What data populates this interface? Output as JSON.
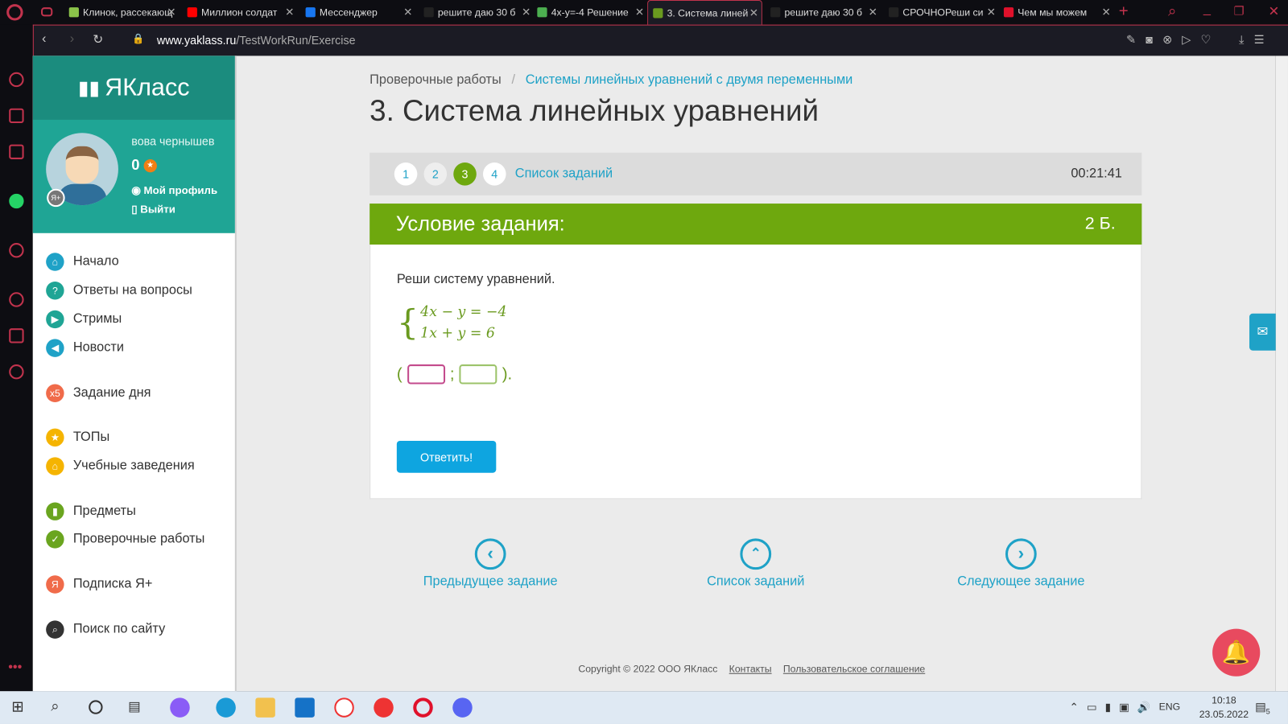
{
  "browser": {
    "tabs": [
      {
        "label": "Клинок, рассекающ",
        "color": "#8bc34a"
      },
      {
        "label": "Миллион солдат",
        "color": "#ff0000"
      },
      {
        "label": "Мессенджер",
        "color": "#1877f2"
      },
      {
        "label": "решите даю 30 б",
        "color": "#222"
      },
      {
        "label": "4x-y=-4 Решение",
        "color": "#4caf50"
      },
      {
        "label": "3. Система линей",
        "color": "#6a9a1f"
      },
      {
        "label": "решите даю 30 б",
        "color": "#222"
      },
      {
        "label": "СРОЧНОРеши си",
        "color": "#222"
      },
      {
        "label": "Чем мы можем",
        "color": "#e0112b"
      }
    ],
    "url_domain": "www.yaklass.ru",
    "url_path": "/TestWorkRun/Exercise",
    "add_tab": "+"
  },
  "site": {
    "logo": "ЯКласс",
    "user": {
      "name": "вова чернышев",
      "points": "0",
      "profile": "Мой профиль",
      "logout": "Выйти",
      "badge": "Я+"
    },
    "nav": [
      {
        "label": "Начало",
        "icon": "home-icon",
        "color": "#1fa2c7"
      },
      {
        "label": "Ответы на вопросы",
        "icon": "question-icon",
        "color": "#1fa595"
      },
      {
        "label": "Стримы",
        "icon": "play-icon",
        "color": "#1fa595"
      },
      {
        "label": "Новости",
        "icon": "megaphone-icon",
        "color": "#1fa2c7"
      },
      {
        "label": "Задание дня",
        "icon": "x5-icon",
        "color": "#f06b4a"
      },
      {
        "label": "ТОПы",
        "icon": "star-icon",
        "color": "#f5b400"
      },
      {
        "label": "Учебные заведения",
        "icon": "school-icon",
        "color": "#f5b400"
      },
      {
        "label": "Предметы",
        "icon": "book-icon",
        "color": "#6aa51f"
      },
      {
        "label": "Проверочные работы",
        "icon": "check-icon",
        "color": "#6aa51f"
      },
      {
        "label": "Подписка Я+",
        "icon": "subscription-icon",
        "color": "#f06b4a"
      },
      {
        "label": "Поиск по сайту",
        "icon": "search-icon",
        "color": "#333"
      }
    ]
  },
  "main": {
    "breadcrumb_root": "Проверочные работы",
    "breadcrumb_sep": "/",
    "breadcrumb_current": "Системы линейных уравнений с двумя переменными",
    "title": "3. Система линейных уравнений",
    "steps": [
      "1",
      "2",
      "3",
      "4"
    ],
    "task_list_link": "Список заданий",
    "timer": "00:21:41",
    "condition_label": "Условие задания:",
    "points": "2 Б.",
    "prompt": "Реши систему уравнений.",
    "eq1": "4x − y = −4",
    "eq2": "1x + y = 6",
    "paren_open": "(",
    "semicolon": ";",
    "paren_close": ").",
    "answer_x": "",
    "answer_y": "",
    "submit": "Ответить!",
    "prev": "Предыдущее задание",
    "list": "Список заданий",
    "next": "Следующее задание",
    "copyright": "Copyright © 2022 ООО ЯКласс",
    "contacts": "Контакты",
    "agreement": "Пользовательское соглашение"
  },
  "taskbar": {
    "lang": "ENG",
    "time": "10:18",
    "date": "23.05.2022",
    "notif": "5"
  }
}
